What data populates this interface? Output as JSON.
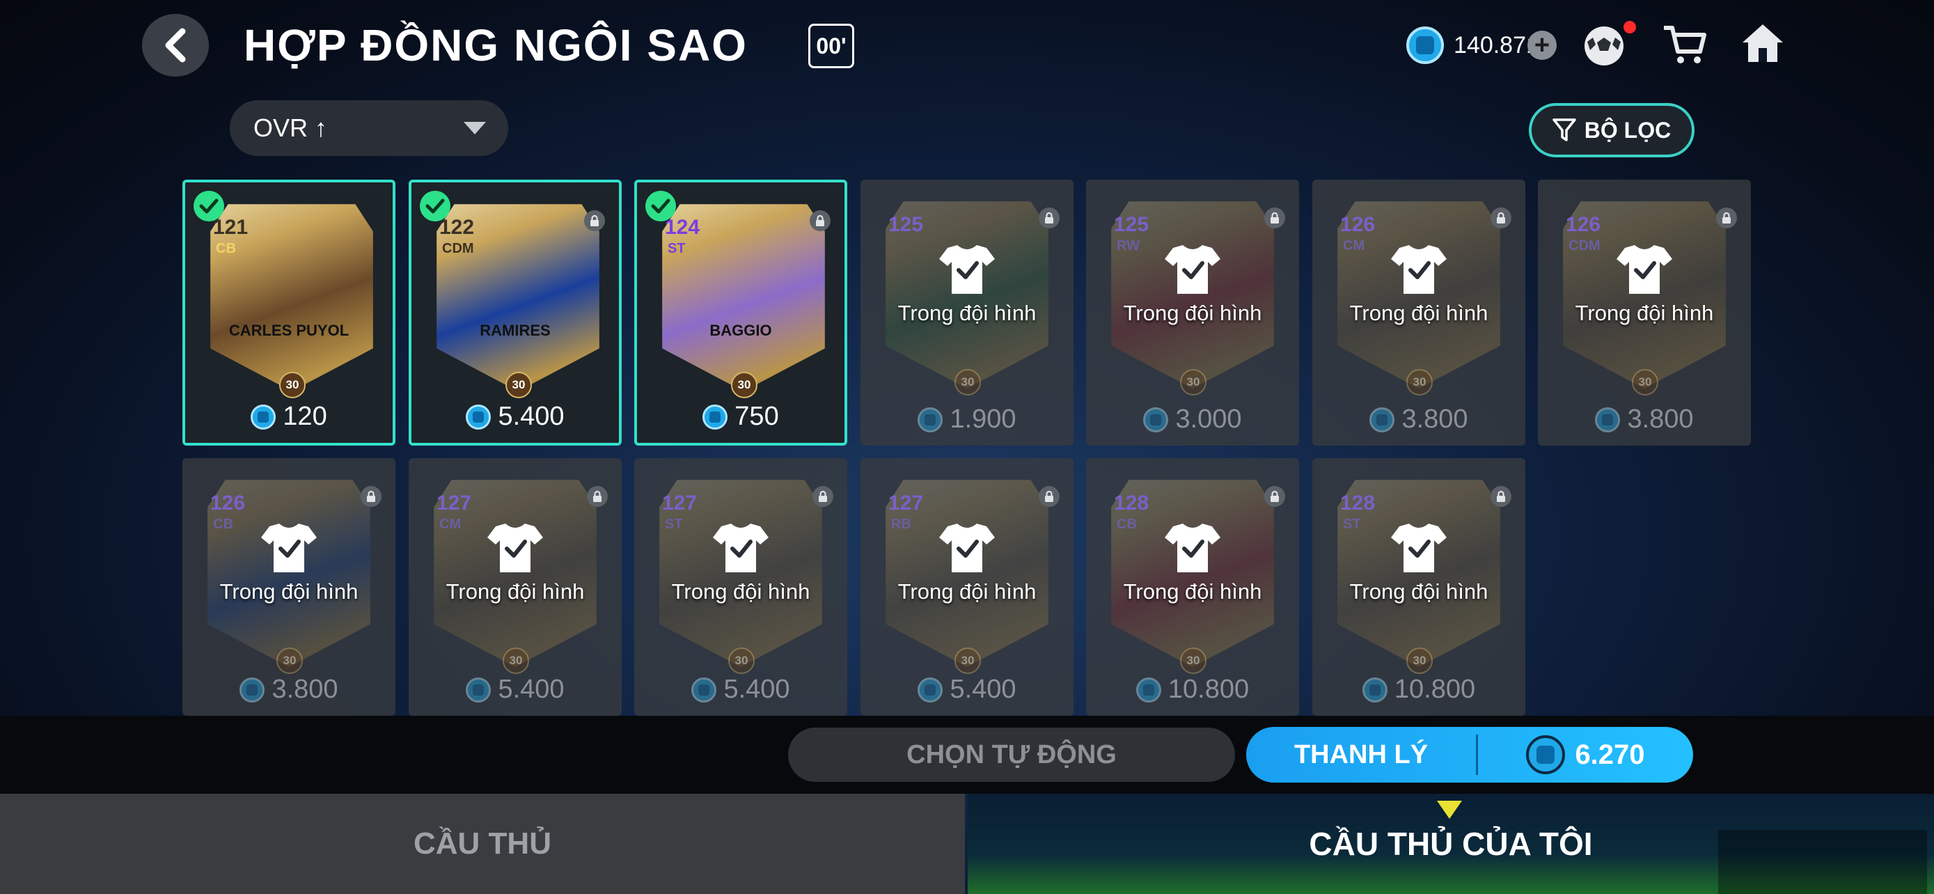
{
  "header": {
    "title": "HỢP ĐỒNG NGÔI SAO",
    "season_badge": "00'",
    "currency": "140.871"
  },
  "sort": {
    "label": "OVR ↑"
  },
  "filter": {
    "label": "BỘ LỌC"
  },
  "cards": [
    {
      "selected": true,
      "locked": false,
      "in_squad": false,
      "ovr": "121",
      "position": "CB",
      "name": "CARLES PUYOL",
      "price": "120",
      "art": "#6b4a2a"
    },
    {
      "selected": true,
      "locked": true,
      "in_squad": false,
      "ovr": "122",
      "position": "CDM",
      "name": "RAMIRES",
      "price": "5.400",
      "art": "#1a3f9c"
    },
    {
      "selected": true,
      "locked": true,
      "in_squad": false,
      "ovr": "124",
      "position": "ST",
      "name": "BAGGIO",
      "price": "750",
      "art": "#8b6cc9"
    },
    {
      "selected": false,
      "locked": true,
      "in_squad": true,
      "ovr": "125",
      "position": "",
      "name": "",
      "price": "1.900",
      "art": "#2d6b3a"
    },
    {
      "selected": false,
      "locked": true,
      "in_squad": true,
      "ovr": "125",
      "position": "RW",
      "name": "",
      "price": "3.000",
      "art": "#a02a2a"
    },
    {
      "selected": false,
      "locked": true,
      "in_squad": true,
      "ovr": "126",
      "position": "CM",
      "name": "",
      "price": "3.800",
      "art": "#6d5a3a"
    },
    {
      "selected": false,
      "locked": true,
      "in_squad": true,
      "ovr": "126",
      "position": "CDM",
      "name": "",
      "price": "3.800",
      "art": "#6d5a3a"
    },
    {
      "selected": false,
      "locked": true,
      "in_squad": true,
      "ovr": "126",
      "position": "CB",
      "name": "",
      "price": "3.800",
      "art": "#1b4a9a"
    },
    {
      "selected": false,
      "locked": true,
      "in_squad": true,
      "ovr": "127",
      "position": "CM",
      "name": "",
      "price": "5.400",
      "art": "#6d5a3a"
    },
    {
      "selected": false,
      "locked": true,
      "in_squad": true,
      "ovr": "127",
      "position": "ST",
      "name": "",
      "price": "5.400",
      "art": "#6d5a3a"
    },
    {
      "selected": false,
      "locked": true,
      "in_squad": true,
      "ovr": "127",
      "position": "RB",
      "name": "",
      "price": "5.400",
      "art": "#6d5a3a"
    },
    {
      "selected": false,
      "locked": true,
      "in_squad": true,
      "ovr": "128",
      "position": "CB",
      "name": "",
      "price": "10.800",
      "art": "#a02a2a"
    },
    {
      "selected": false,
      "locked": true,
      "in_squad": true,
      "ovr": "128",
      "position": "ST",
      "name": "",
      "price": "10.800",
      "art": "#6d5a3a"
    }
  ],
  "in_squad_label": "Trong đội hình",
  "card_badge": "30",
  "actions": {
    "auto_select": "CHỌN TỰ ĐỘNG",
    "sell_label": "THANH LÝ",
    "sell_amount": "6.270"
  },
  "tabs": {
    "players": "CẦU THỦ",
    "my_players": "CẦU THỦ CỦA TÔI"
  },
  "colors": {
    "accent_teal": "#33e0c9",
    "sell_blue": "#1a9ff0",
    "check_green": "#2de08a"
  }
}
